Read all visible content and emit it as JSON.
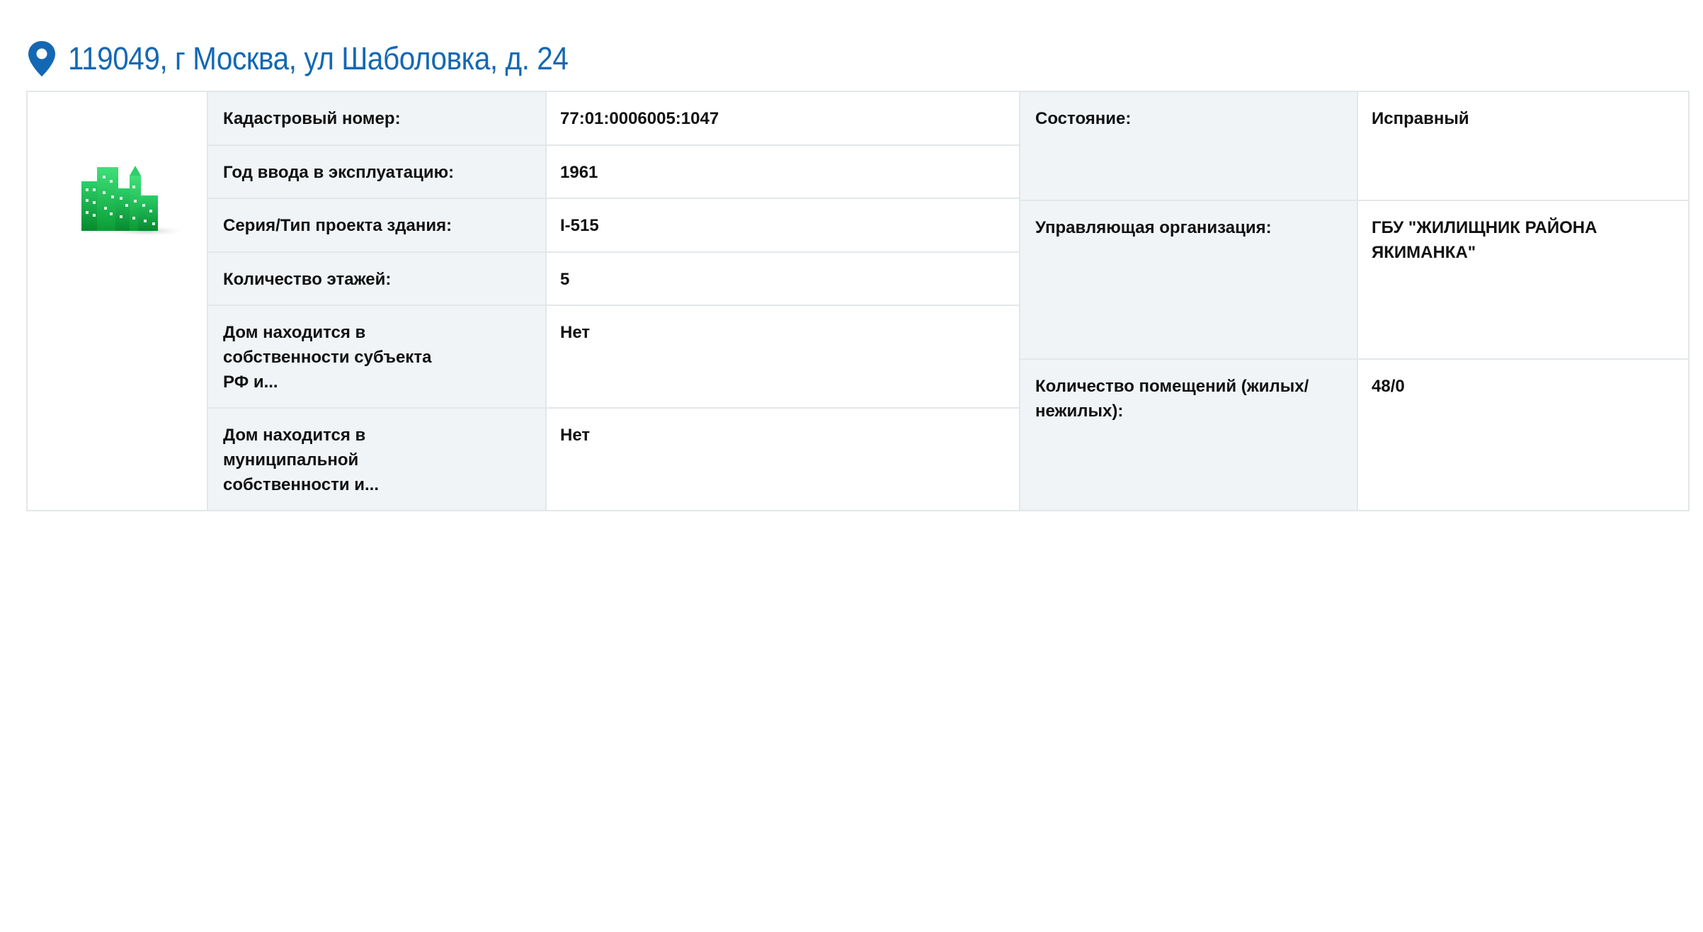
{
  "header": {
    "address": "119049, г Москва, ул Шаболовка, д. 24",
    "pin_icon": "location-pin-icon",
    "accent_color": "#1468b3"
  },
  "building_icon": "building-icon",
  "left_rows": [
    {
      "label": "Кадастровый номер:",
      "value": "77:01:0006005:1047"
    },
    {
      "label": "Год ввода в эксплуатацию:",
      "value": "1961"
    },
    {
      "label": "Серия/Тип проекта здания:",
      "value": "I-515"
    },
    {
      "label": "Количество этажей:",
      "value": "5"
    },
    {
      "label": "Дом находится в собственности субъекта РФ и...",
      "value": "Нет"
    },
    {
      "label": "Дом находится в муниципальной собственности и...",
      "value": "Нет"
    }
  ],
  "right_rows": [
    {
      "label": "Состояние:",
      "value": "Исправный"
    },
    {
      "label": "Управляющая организация:",
      "value": "ГБУ \"ЖИЛИЩНИК РАЙОНА ЯКИМАНКА\""
    },
    {
      "label": "Количество помещений (жилых/нежилых):",
      "value": "48/0"
    }
  ]
}
